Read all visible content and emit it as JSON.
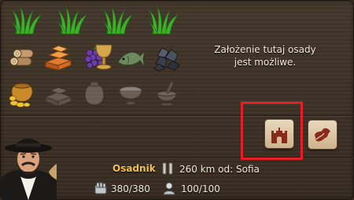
{
  "resources": {
    "row1": [
      {
        "icon": "grass-icon",
        "available": true
      },
      {
        "icon": "grass-icon",
        "available": true
      },
      {
        "icon": "grass-icon",
        "available": true
      },
      {
        "icon": "grass-icon",
        "available": true
      }
    ],
    "row2": [
      {
        "icon": "wood-logs-icon",
        "available": true
      },
      {
        "icon": "copper-ingots-icon",
        "available": true
      },
      {
        "icon": "grapes-icon",
        "available": true
      },
      {
        "icon": "goblet-icon",
        "available": true
      },
      {
        "icon": "fish-icon",
        "available": true
      },
      {
        "icon": "coal-icon",
        "available": true
      }
    ],
    "row3": [
      {
        "icon": "gold-pot-icon",
        "available": true
      },
      {
        "icon": "bricks-icon",
        "available": false
      },
      {
        "icon": "sack-icon",
        "available": false
      },
      {
        "icon": "flour-bowl-icon",
        "available": false
      },
      {
        "icon": "mortar-icon",
        "available": false
      }
    ]
  },
  "message": "Założenie tutaj osady jest możliwe.",
  "actions": {
    "found_settlement": {
      "icon": "castle-icon",
      "highlighted": true
    },
    "other_action": {
      "icon": "map-scroll-icon"
    }
  },
  "unit": {
    "name": "Osadnik",
    "distance_text": "260 km od: Sofia",
    "strength": "380/380",
    "population": "100/100"
  },
  "colors": {
    "highlight": "#e31e24",
    "name": "#f0c24a",
    "panel": "#3c3226"
  }
}
